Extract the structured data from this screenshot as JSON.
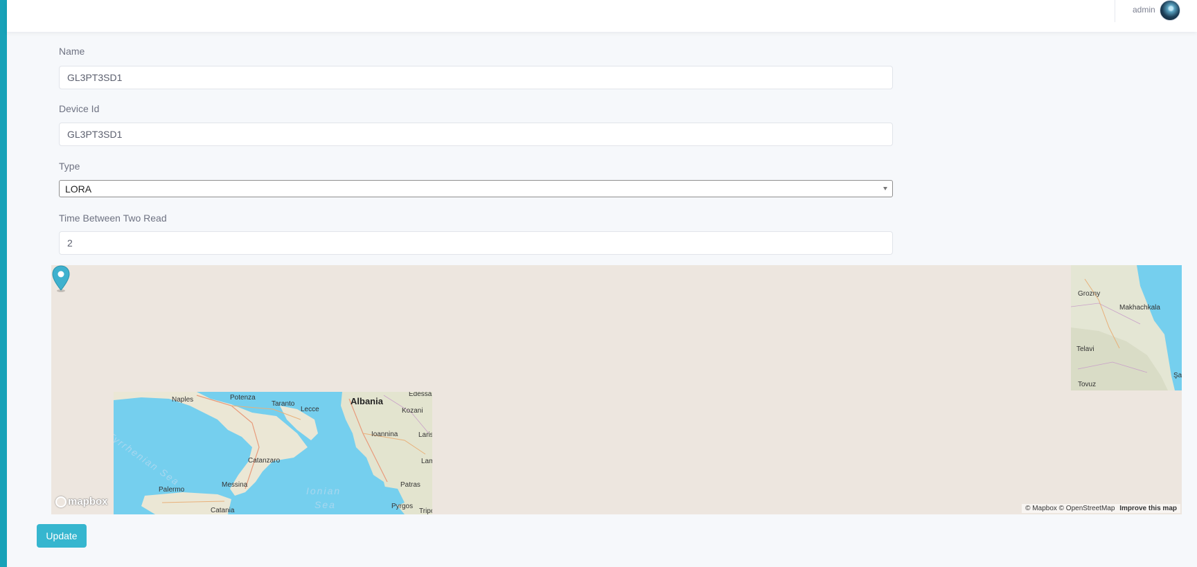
{
  "header": {
    "user_name": "admin",
    "avatar_icon": "user-avatar"
  },
  "form": {
    "name": {
      "label": "Name",
      "value": "GL3PT3SD1"
    },
    "device_id": {
      "label": "Device Id",
      "value": "GL3PT3SD1"
    },
    "type": {
      "label": "Type",
      "selected": "LORA"
    },
    "time_between": {
      "label": "Time Between Two Read",
      "value": "2"
    }
  },
  "map": {
    "labels": {
      "naples": "Naples",
      "potenza": "Potenza",
      "taranto": "Taranto",
      "lecce": "Lecce",
      "albania": "Albania",
      "edessa": "Edessa",
      "kozani": "Kozani",
      "ioannina": "Ioannina",
      "larissa": "Larissa",
      "lamia": "Lamia",
      "catanzaro": "Catanzaro",
      "palermo": "Palermo",
      "messina": "Messina",
      "patras": "Patras",
      "pyrgos": "Pyrgos",
      "catania": "Catania",
      "tripoli": "Tripoli",
      "tyrrhenian_sea": "Tyrrhenian Sea",
      "ionian": "Ionian",
      "sea": "Sea",
      "grozny": "Grozny",
      "makhachkala": "Makhachkala",
      "telavi": "Telavi",
      "tovuz": "Tovuz",
      "shamakhi_partial": "Şa"
    },
    "logo": "mapbox",
    "attribution": "© Mapbox © OpenStreetMap",
    "improve_link": "Improve this map"
  },
  "actions": {
    "update_label": "Update"
  },
  "colors": {
    "accent": "#17a2b8",
    "button": "#36b6cf",
    "water": "#75cfee"
  }
}
